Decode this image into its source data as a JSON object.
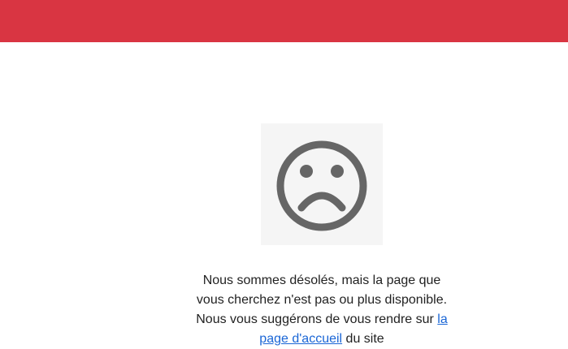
{
  "header": {
    "color": "#d93542"
  },
  "error": {
    "icon": "sad-face-icon",
    "icon_color": "#666666",
    "panel_color": "#f5f5f5"
  },
  "message": {
    "text_before": "Nous sommes désolés, mais la page que vous cherchez n'est pas ou plus disponible. Nous vous suggérons de vous rendre sur ",
    "link_label": "la page d'accueil",
    "text_after": " du site",
    "link_color": "#1a66d6"
  }
}
